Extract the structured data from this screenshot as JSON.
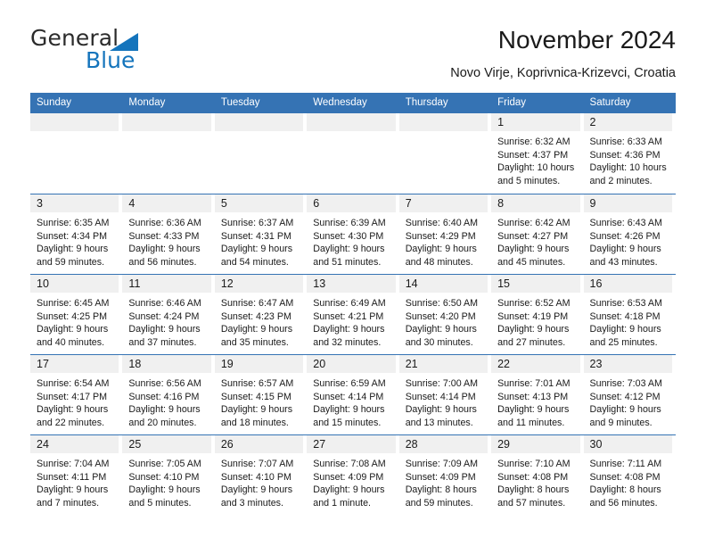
{
  "brand": {
    "name_top": "General",
    "name_bottom": "Blue",
    "accent_color": "#1474bc"
  },
  "header": {
    "title": "November 2024",
    "subtitle": "Novo Virje, Koprivnica-Krizevci, Croatia",
    "header_bar_color": "#3573b4"
  },
  "calendar": {
    "weekday_headers": [
      "Sunday",
      "Monday",
      "Tuesday",
      "Wednesday",
      "Thursday",
      "Friday",
      "Saturday"
    ],
    "weeks": [
      [
        {
          "day": "",
          "lines": []
        },
        {
          "day": "",
          "lines": []
        },
        {
          "day": "",
          "lines": []
        },
        {
          "day": "",
          "lines": []
        },
        {
          "day": "",
          "lines": []
        },
        {
          "day": "1",
          "lines": [
            "Sunrise: 6:32 AM",
            "Sunset: 4:37 PM",
            "Daylight: 10 hours",
            "and 5 minutes."
          ]
        },
        {
          "day": "2",
          "lines": [
            "Sunrise: 6:33 AM",
            "Sunset: 4:36 PM",
            "Daylight: 10 hours",
            "and 2 minutes."
          ]
        }
      ],
      [
        {
          "day": "3",
          "lines": [
            "Sunrise: 6:35 AM",
            "Sunset: 4:34 PM",
            "Daylight: 9 hours",
            "and 59 minutes."
          ]
        },
        {
          "day": "4",
          "lines": [
            "Sunrise: 6:36 AM",
            "Sunset: 4:33 PM",
            "Daylight: 9 hours",
            "and 56 minutes."
          ]
        },
        {
          "day": "5",
          "lines": [
            "Sunrise: 6:37 AM",
            "Sunset: 4:31 PM",
            "Daylight: 9 hours",
            "and 54 minutes."
          ]
        },
        {
          "day": "6",
          "lines": [
            "Sunrise: 6:39 AM",
            "Sunset: 4:30 PM",
            "Daylight: 9 hours",
            "and 51 minutes."
          ]
        },
        {
          "day": "7",
          "lines": [
            "Sunrise: 6:40 AM",
            "Sunset: 4:29 PM",
            "Daylight: 9 hours",
            "and 48 minutes."
          ]
        },
        {
          "day": "8",
          "lines": [
            "Sunrise: 6:42 AM",
            "Sunset: 4:27 PM",
            "Daylight: 9 hours",
            "and 45 minutes."
          ]
        },
        {
          "day": "9",
          "lines": [
            "Sunrise: 6:43 AM",
            "Sunset: 4:26 PM",
            "Daylight: 9 hours",
            "and 43 minutes."
          ]
        }
      ],
      [
        {
          "day": "10",
          "lines": [
            "Sunrise: 6:45 AM",
            "Sunset: 4:25 PM",
            "Daylight: 9 hours",
            "and 40 minutes."
          ]
        },
        {
          "day": "11",
          "lines": [
            "Sunrise: 6:46 AM",
            "Sunset: 4:24 PM",
            "Daylight: 9 hours",
            "and 37 minutes."
          ]
        },
        {
          "day": "12",
          "lines": [
            "Sunrise: 6:47 AM",
            "Sunset: 4:23 PM",
            "Daylight: 9 hours",
            "and 35 minutes."
          ]
        },
        {
          "day": "13",
          "lines": [
            "Sunrise: 6:49 AM",
            "Sunset: 4:21 PM",
            "Daylight: 9 hours",
            "and 32 minutes."
          ]
        },
        {
          "day": "14",
          "lines": [
            "Sunrise: 6:50 AM",
            "Sunset: 4:20 PM",
            "Daylight: 9 hours",
            "and 30 minutes."
          ]
        },
        {
          "day": "15",
          "lines": [
            "Sunrise: 6:52 AM",
            "Sunset: 4:19 PM",
            "Daylight: 9 hours",
            "and 27 minutes."
          ]
        },
        {
          "day": "16",
          "lines": [
            "Sunrise: 6:53 AM",
            "Sunset: 4:18 PM",
            "Daylight: 9 hours",
            "and 25 minutes."
          ]
        }
      ],
      [
        {
          "day": "17",
          "lines": [
            "Sunrise: 6:54 AM",
            "Sunset: 4:17 PM",
            "Daylight: 9 hours",
            "and 22 minutes."
          ]
        },
        {
          "day": "18",
          "lines": [
            "Sunrise: 6:56 AM",
            "Sunset: 4:16 PM",
            "Daylight: 9 hours",
            "and 20 minutes."
          ]
        },
        {
          "day": "19",
          "lines": [
            "Sunrise: 6:57 AM",
            "Sunset: 4:15 PM",
            "Daylight: 9 hours",
            "and 18 minutes."
          ]
        },
        {
          "day": "20",
          "lines": [
            "Sunrise: 6:59 AM",
            "Sunset: 4:14 PM",
            "Daylight: 9 hours",
            "and 15 minutes."
          ]
        },
        {
          "day": "21",
          "lines": [
            "Sunrise: 7:00 AM",
            "Sunset: 4:14 PM",
            "Daylight: 9 hours",
            "and 13 minutes."
          ]
        },
        {
          "day": "22",
          "lines": [
            "Sunrise: 7:01 AM",
            "Sunset: 4:13 PM",
            "Daylight: 9 hours",
            "and 11 minutes."
          ]
        },
        {
          "day": "23",
          "lines": [
            "Sunrise: 7:03 AM",
            "Sunset: 4:12 PM",
            "Daylight: 9 hours",
            "and 9 minutes."
          ]
        }
      ],
      [
        {
          "day": "24",
          "lines": [
            "Sunrise: 7:04 AM",
            "Sunset: 4:11 PM",
            "Daylight: 9 hours",
            "and 7 minutes."
          ]
        },
        {
          "day": "25",
          "lines": [
            "Sunrise: 7:05 AM",
            "Sunset: 4:10 PM",
            "Daylight: 9 hours",
            "and 5 minutes."
          ]
        },
        {
          "day": "26",
          "lines": [
            "Sunrise: 7:07 AM",
            "Sunset: 4:10 PM",
            "Daylight: 9 hours",
            "and 3 minutes."
          ]
        },
        {
          "day": "27",
          "lines": [
            "Sunrise: 7:08 AM",
            "Sunset: 4:09 PM",
            "Daylight: 9 hours",
            "and 1 minute."
          ]
        },
        {
          "day": "28",
          "lines": [
            "Sunrise: 7:09 AM",
            "Sunset: 4:09 PM",
            "Daylight: 8 hours",
            "and 59 minutes."
          ]
        },
        {
          "day": "29",
          "lines": [
            "Sunrise: 7:10 AM",
            "Sunset: 4:08 PM",
            "Daylight: 8 hours",
            "and 57 minutes."
          ]
        },
        {
          "day": "30",
          "lines": [
            "Sunrise: 7:11 AM",
            "Sunset: 4:08 PM",
            "Daylight: 8 hours",
            "and 56 minutes."
          ]
        }
      ]
    ]
  }
}
